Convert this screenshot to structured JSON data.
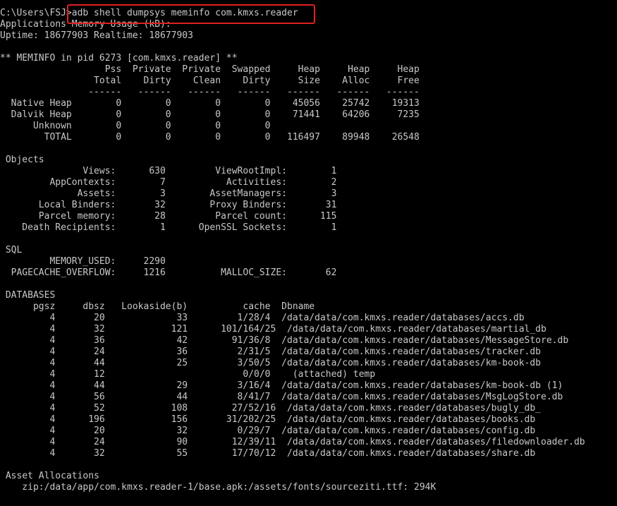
{
  "highlight_color": "#e02020",
  "text_color": "#c8c8c8",
  "background_color": "#000000",
  "lines": [
    "C:\\Users\\FSJ>adb shell dumpsys meminfo com.kmxs.reader",
    "Applications Memory Usage (kB):",
    "Uptime: 18677903 Realtime: 18677903",
    "",
    "** MEMINFO in pid 6273 [com.kmxs.reader] **",
    "                   Pss  Private  Private  Swapped     Heap     Heap     Heap",
    "                 Total    Dirty    Clean    Dirty     Size    Alloc     Free",
    "                ------   ------   ------   ------   ------   ------   ------",
    "  Native Heap        0        0        0        0    45056    25742    19313",
    "  Dalvik Heap        0        0        0        0    71441    64206     7235",
    "      Unknown        0        0        0        0",
    "        TOTAL        0        0        0        0   116497    89948    26548",
    "",
    " Objects",
    "               Views:      630         ViewRootImpl:        1",
    "         AppContexts:        7           Activities:        2",
    "              Assets:        3        AssetManagers:        3",
    "       Local Binders:       32        Proxy Binders:       31",
    "       Parcel memory:       28         Parcel count:      115",
    "    Death Recipients:        1      OpenSSL Sockets:        1",
    "",
    " SQL",
    "         MEMORY_USED:     2290",
    "  PAGECACHE_OVERFLOW:     1216          MALLOC_SIZE:       62",
    "",
    " DATABASES",
    "      pgsz     dbsz   Lookaside(b)          cache  Dbname",
    "         4       20             33         1/28/4  /data/data/com.kmxs.reader/databases/accs.db",
    "         4       32            121      101/164/25  /data/data/com.kmxs.reader/databases/martial_db",
    "         4       36             42        91/36/8  /data/data/com.kmxs.reader/databases/MessageStore.db",
    "         4       24             36         2/31/5  /data/data/com.kmxs.reader/databases/tracker.db",
    "         4       44             25         3/50/5  /data/data/com.kmxs.reader/databases/km-book-db",
    "         4       12                         0/0/0    (attached) temp",
    "         4       44             29         3/16/4  /data/data/com.kmxs.reader/databases/km-book-db (1)",
    "         4       56             44         8/41/7  /data/data/com.kmxs.reader/databases/MsgLogStore.db",
    "         4       52            108        27/52/16  /data/data/com.kmxs.reader/databases/bugly_db_",
    "         4      196            156       31/202/25  /data/data/com.kmxs.reader/databases/books.db",
    "         4       20             32         0/29/7  /data/data/com.kmxs.reader/databases/config.db",
    "         4       24             90        12/39/11  /data/data/com.kmxs.reader/databases/filedownloader.db",
    "         4       32             55        17/70/12  /data/data/com.kmxs.reader/databases/share.db",
    "",
    " Asset Allocations",
    "    zip:/data/app/com.kmxs.reader-1/base.apk:/assets/fonts/sourceziti.ttf: 294K"
  ]
}
